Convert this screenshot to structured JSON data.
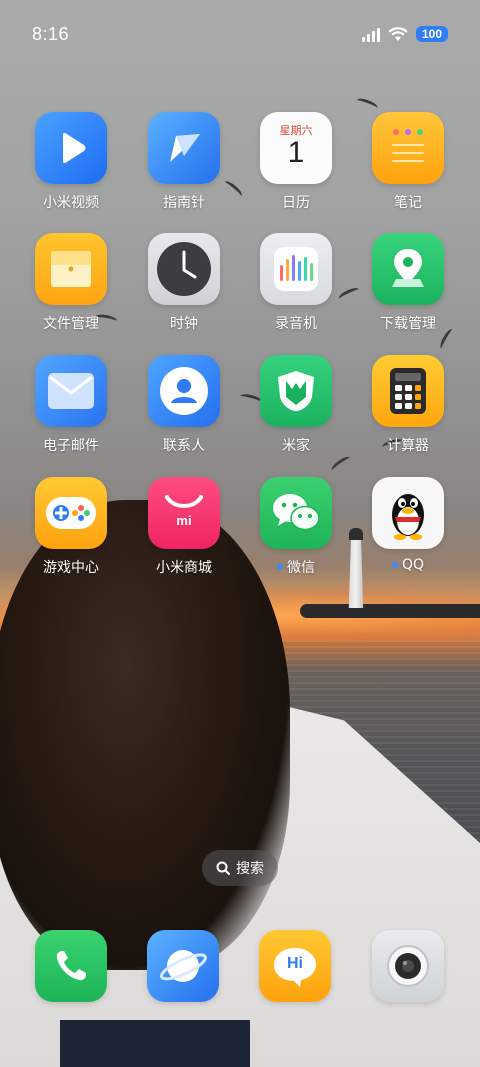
{
  "status_bar": {
    "time": "8:16",
    "battery": "100"
  },
  "apps": [
    {
      "label": "小米视频",
      "icon": "video-play-icon"
    },
    {
      "label": "指南针",
      "icon": "compass-icon"
    },
    {
      "label": "日历",
      "icon": "calendar-icon",
      "weekday": "星期六",
      "day": "1"
    },
    {
      "label": "笔记",
      "icon": "notes-icon"
    },
    {
      "label": "文件管理",
      "icon": "folder-icon"
    },
    {
      "label": "时钟",
      "icon": "clock-icon"
    },
    {
      "label": "录音机",
      "icon": "sound-recorder-icon"
    },
    {
      "label": "下载管理",
      "icon": "download-pin-icon"
    },
    {
      "label": "电子邮件",
      "icon": "mail-icon"
    },
    {
      "label": "联系人",
      "icon": "contact-person-icon"
    },
    {
      "label": "米家",
      "icon": "mijia-shield-icon"
    },
    {
      "label": "计算器",
      "icon": "calculator-icon"
    },
    {
      "label": "游戏中心",
      "icon": "gamepad-icon"
    },
    {
      "label": "小米商城",
      "icon": "mi-bag-icon",
      "logo": "mi"
    },
    {
      "label": "微信",
      "icon": "wechat-bubbles-icon"
    },
    {
      "label": "QQ",
      "icon": "qq-penguin-icon"
    }
  ],
  "search": {
    "label": "搜索"
  },
  "dock": [
    {
      "icon": "phone-icon"
    },
    {
      "icon": "browser-planet-icon"
    },
    {
      "icon": "messages-hi-icon",
      "text": "Hi"
    },
    {
      "icon": "camera-icon"
    }
  ]
}
